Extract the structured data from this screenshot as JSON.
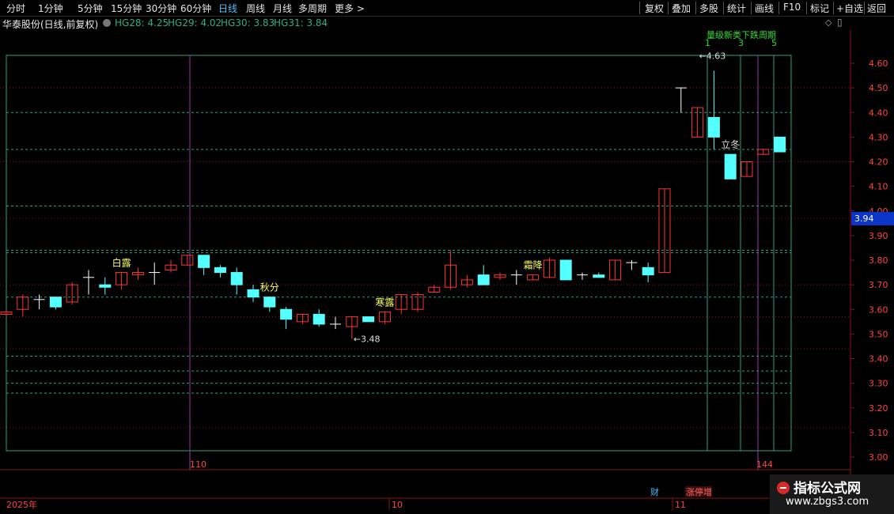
{
  "toolbar": {
    "items": [
      "分时",
      "1分钟",
      "5分钟",
      "15分钟",
      "30分钟",
      "60分钟",
      "日线",
      "周线",
      "月线",
      "多周期",
      "更多 >"
    ],
    "active": "日线",
    "right_items": [
      "复权",
      "叠加",
      "多股",
      "统计",
      "画线",
      "F10",
      "标记",
      "+自选",
      "返回"
    ]
  },
  "title": {
    "stock": "华泰股份(日线,前复权)",
    "indicators": [
      {
        "label": "HG28: 4.25",
        "color": "#2fae84"
      },
      {
        "label": "HG29: 4.02",
        "color": "#2fae84"
      },
      {
        "label": "HG30: 3.83",
        "color": "#2fae84"
      },
      {
        "label": "HG31: 3.84",
        "color": "#2fae84"
      }
    ]
  },
  "colors": {
    "up": "#ff3333",
    "down": "#54ffff",
    "grid": "#8b1010",
    "teal": "#2aa185",
    "purple": "#9b3aa9",
    "label_yellow": "#ffff66",
    "label_white": "#e0e0e0"
  },
  "axis": {
    "price_labels": [
      "4.60",
      "4.50",
      "4.40",
      "4.30",
      "4.20",
      "4.10",
      "4.00",
      "3.90",
      "3.80",
      "3.70",
      "3.60",
      "3.50",
      "3.40",
      "3.30",
      "3.20",
      "3.10",
      "3.00"
    ],
    "current_price": "3.94",
    "x_labels": [
      {
        "text": "110"
      },
      {
        "text": "144"
      }
    ],
    "date_labels": [
      {
        "text": "2025年"
      },
      {
        "text": "10"
      },
      {
        "text": "11"
      }
    ],
    "marker_fin": "财",
    "marker_zt": "涨停增"
  },
  "chart_data": {
    "type": "candlestick",
    "ylim": [
      3.0,
      4.63
    ],
    "candles": [
      {
        "o": 3.58,
        "c": 3.59,
        "h": 3.6,
        "l": 3.57
      },
      {
        "o": 3.6,
        "c": 3.65,
        "h": 3.66,
        "l": 3.57
      },
      {
        "o": 3.64,
        "c": 3.64,
        "h": 3.66,
        "l": 3.6
      },
      {
        "o": 3.65,
        "c": 3.61,
        "h": 3.65,
        "l": 3.6
      },
      {
        "o": 3.63,
        "c": 3.7,
        "h": 3.71,
        "l": 3.62
      },
      {
        "o": 3.73,
        "c": 3.73,
        "h": 3.76,
        "l": 3.66
      },
      {
        "o": 3.7,
        "c": 3.69,
        "h": 3.73,
        "l": 3.66
      },
      {
        "o": 3.7,
        "c": 3.75,
        "h": 3.75,
        "l": 3.68
      },
      {
        "o": 3.74,
        "c": 3.75,
        "h": 3.77,
        "l": 3.72
      },
      {
        "o": 3.75,
        "c": 3.75,
        "h": 3.79,
        "l": 3.7
      },
      {
        "o": 3.76,
        "c": 3.78,
        "h": 3.8,
        "l": 3.75
      },
      {
        "o": 3.78,
        "c": 3.82,
        "h": 3.82,
        "l": 3.78
      },
      {
        "o": 3.82,
        "c": 3.77,
        "h": 3.82,
        "l": 3.74
      },
      {
        "o": 3.77,
        "c": 3.75,
        "h": 3.78,
        "l": 3.73
      },
      {
        "o": 3.75,
        "c": 3.7,
        "h": 3.77,
        "l": 3.66
      },
      {
        "o": 3.68,
        "c": 3.65,
        "h": 3.7,
        "l": 3.63
      },
      {
        "o": 3.65,
        "c": 3.61,
        "h": 3.65,
        "l": 3.59
      },
      {
        "o": 3.6,
        "c": 3.56,
        "h": 3.61,
        "l": 3.52
      },
      {
        "o": 3.55,
        "c": 3.58,
        "h": 3.58,
        "l": 3.54
      },
      {
        "o": 3.58,
        "c": 3.54,
        "h": 3.6,
        "l": 3.53
      },
      {
        "o": 3.54,
        "c": 3.54,
        "h": 3.57,
        "l": 3.52
      },
      {
        "o": 3.53,
        "c": 3.57,
        "h": 3.57,
        "l": 3.48
      },
      {
        "o": 3.57,
        "c": 3.55,
        "h": 3.57,
        "l": 3.55
      },
      {
        "o": 3.55,
        "c": 3.59,
        "h": 3.59,
        "l": 3.54
      },
      {
        "o": 3.6,
        "c": 3.66,
        "h": 3.66,
        "l": 3.58
      },
      {
        "o": 3.6,
        "c": 3.66,
        "h": 3.67,
        "l": 3.59
      },
      {
        "o": 3.67,
        "c": 3.69,
        "h": 3.7,
        "l": 3.67
      },
      {
        "o": 3.69,
        "c": 3.78,
        "h": 3.84,
        "l": 3.68
      },
      {
        "o": 3.7,
        "c": 3.72,
        "h": 3.74,
        "l": 3.69
      },
      {
        "o": 3.74,
        "c": 3.7,
        "h": 3.78,
        "l": 3.7
      },
      {
        "o": 3.73,
        "c": 3.74,
        "h": 3.75,
        "l": 3.72
      },
      {
        "o": 3.74,
        "c": 3.74,
        "h": 3.76,
        "l": 3.7
      },
      {
        "o": 3.72,
        "c": 3.74,
        "h": 3.74,
        "l": 3.72
      },
      {
        "o": 3.73,
        "c": 3.8,
        "h": 3.81,
        "l": 3.73
      },
      {
        "o": 3.8,
        "c": 3.72,
        "h": 3.8,
        "l": 3.72
      },
      {
        "o": 3.74,
        "c": 3.74,
        "h": 3.75,
        "l": 3.72
      },
      {
        "o": 3.74,
        "c": 3.73,
        "h": 3.75,
        "l": 3.73
      },
      {
        "o": 3.72,
        "c": 3.8,
        "h": 3.8,
        "l": 3.72
      },
      {
        "o": 3.79,
        "c": 3.79,
        "h": 3.8,
        "l": 3.76
      },
      {
        "o": 3.77,
        "c": 3.74,
        "h": 3.79,
        "l": 3.71
      },
      {
        "o": 3.75,
        "c": 4.09,
        "h": 4.09,
        "l": 3.75
      },
      {
        "o": 4.5,
        "c": 4.5,
        "h": 4.5,
        "l": 4.4
      },
      {
        "o": 4.3,
        "c": 4.42,
        "h": 4.42,
        "l": 4.3
      },
      {
        "o": 4.38,
        "c": 4.3,
        "h": 4.57,
        "l": 4.25
      },
      {
        "o": 4.23,
        "c": 4.13,
        "h": 4.23,
        "l": 4.13
      },
      {
        "o": 4.14,
        "c": 4.2,
        "h": 4.2,
        "l": 4.14
      },
      {
        "o": 4.23,
        "c": 4.25,
        "h": 4.25,
        "l": 4.23
      },
      {
        "o": 4.3,
        "c": 4.24,
        "h": 4.3,
        "l": 4.24
      }
    ],
    "solar_terms": [
      {
        "text": "白露",
        "color": "label_yellow",
        "candle": 7
      },
      {
        "text": "秋分",
        "color": "label_yellow",
        "candle": 16
      },
      {
        "text": "寒露",
        "color": "label_yellow",
        "candle": 23
      },
      {
        "text": "霜降",
        "color": "label_yellow",
        "candle": 32
      },
      {
        "text": "立冬",
        "color": "label_white",
        "candle": 44
      }
    ],
    "price_marks": [
      {
        "text": "3.48",
        "candle": 21,
        "price": 3.48
      },
      {
        "text": "4.63",
        "candle": 42,
        "price": 4.63
      }
    ],
    "top_numbers": [
      "1",
      "3",
      "5"
    ],
    "top_banner": "量级新类下跌周期",
    "dashed_levels": [
      4.4,
      4.25,
      4.02,
      3.83,
      3.84,
      3.65,
      3.41,
      3.35,
      3.3,
      3.26
    ],
    "dotted_red_levels": [
      4.5,
      4.2,
      3.97,
      3.7,
      3.57,
      3.44,
      3.12
    ]
  }
}
